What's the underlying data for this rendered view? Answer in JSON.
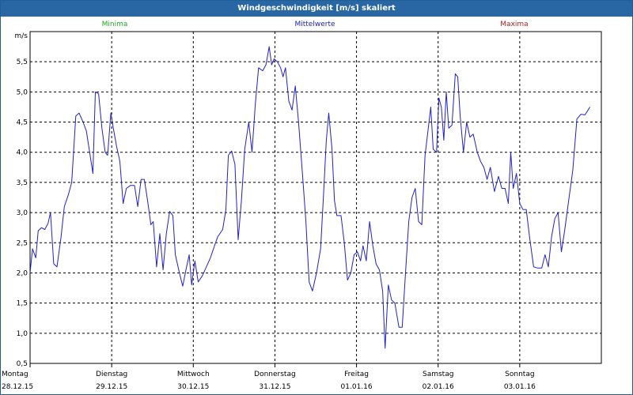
{
  "window": {
    "title": "Windgeschwindigkeit [m/s] skaliert"
  },
  "legend": [
    {
      "label": "Minima",
      "color": "#22aa22"
    },
    {
      "label": "Mittelwerte",
      "color": "#2020cc"
    },
    {
      "label": "Maxima",
      "color": "#aa2222"
    }
  ],
  "chart_data": {
    "type": "line",
    "title": "Windgeschwindigkeit [m/s] skaliert",
    "ylabel": "m/s",
    "xlabel": "",
    "ylim": [
      0.5,
      6.0
    ],
    "yticks": [
      "0,5",
      "1,0",
      "1,5",
      "2,0",
      "2,5",
      "3,0",
      "3,5",
      "4,0",
      "4,5",
      "5,0",
      "5,5"
    ],
    "yticks_values": [
      0.5,
      1.0,
      1.5,
      2.0,
      2.5,
      3.0,
      3.5,
      4.0,
      4.5,
      5.0,
      5.5
    ],
    "xlim": [
      0,
      7
    ],
    "xticks": [
      {
        "day": "Montag",
        "date": "28.12.15"
      },
      {
        "day": "Dienstag",
        "date": "29.12.15"
      },
      {
        "day": "Mittwoch",
        "date": "30.12.15"
      },
      {
        "day": "Donnerstag",
        "date": "31.12.15"
      },
      {
        "day": "Freitag",
        "date": "01.01.16"
      },
      {
        "day": "Samstag",
        "date": "02.01.16"
      },
      {
        "day": "Sonntag",
        "date": "03.01.16"
      }
    ],
    "grid": true,
    "series": [
      {
        "name": "Mittelwerte",
        "color": "#2020cc",
        "points": [
          [
            0.0,
            2.0
          ],
          [
            0.03,
            2.4
          ],
          [
            0.07,
            2.25
          ],
          [
            0.1,
            2.7
          ],
          [
            0.14,
            2.75
          ],
          [
            0.18,
            2.72
          ],
          [
            0.22,
            2.82
          ],
          [
            0.25,
            3.0
          ],
          [
            0.29,
            2.15
          ],
          [
            0.33,
            2.1
          ],
          [
            0.38,
            2.6
          ],
          [
            0.42,
            3.1
          ],
          [
            0.47,
            3.3
          ],
          [
            0.51,
            3.5
          ],
          [
            0.56,
            4.6
          ],
          [
            0.6,
            4.65
          ],
          [
            0.65,
            4.5
          ],
          [
            0.69,
            4.35
          ],
          [
            0.73,
            4.0
          ],
          [
            0.77,
            3.65
          ],
          [
            0.8,
            5.0
          ],
          [
            0.84,
            4.97
          ],
          [
            0.88,
            4.4
          ],
          [
            0.92,
            4.0
          ],
          [
            0.95,
            3.95
          ],
          [
            0.99,
            4.65
          ],
          [
            1.02,
            4.4
          ],
          [
            1.06,
            4.1
          ],
          [
            1.1,
            3.85
          ],
          [
            1.14,
            3.15
          ],
          [
            1.18,
            3.4
          ],
          [
            1.23,
            3.45
          ],
          [
            1.28,
            3.45
          ],
          [
            1.32,
            3.1
          ],
          [
            1.36,
            3.55
          ],
          [
            1.4,
            3.55
          ],
          [
            1.44,
            3.2
          ],
          [
            1.48,
            2.8
          ],
          [
            1.51,
            2.85
          ],
          [
            1.55,
            2.1
          ],
          [
            1.59,
            2.65
          ],
          [
            1.63,
            2.05
          ],
          [
            1.67,
            2.65
          ],
          [
            1.71,
            3.02
          ],
          [
            1.75,
            2.95
          ],
          [
            1.78,
            2.3
          ],
          [
            1.83,
            2.0
          ],
          [
            1.87,
            1.78
          ],
          [
            1.91,
            2.05
          ],
          [
            1.95,
            2.3
          ],
          [
            1.98,
            1.8
          ],
          [
            2.02,
            2.2
          ],
          [
            2.06,
            1.85
          ],
          [
            2.11,
            1.95
          ],
          [
            2.16,
            2.1
          ],
          [
            2.21,
            2.25
          ],
          [
            2.26,
            2.45
          ],
          [
            2.3,
            2.6
          ],
          [
            2.36,
            2.72
          ],
          [
            2.4,
            3.05
          ],
          [
            2.43,
            3.95
          ],
          [
            2.47,
            4.02
          ],
          [
            2.51,
            3.8
          ],
          [
            2.55,
            2.55
          ],
          [
            2.59,
            3.2
          ],
          [
            2.63,
            4.05
          ],
          [
            2.68,
            4.5
          ],
          [
            2.72,
            4.0
          ],
          [
            2.76,
            4.8
          ],
          [
            2.8,
            5.4
          ],
          [
            2.85,
            5.35
          ],
          [
            2.89,
            5.45
          ],
          [
            2.93,
            5.75
          ],
          [
            2.96,
            5.45
          ],
          [
            2.99,
            5.55
          ],
          [
            3.03,
            5.5
          ],
          [
            3.07,
            5.4
          ],
          [
            3.1,
            5.25
          ],
          [
            3.13,
            5.4
          ],
          [
            3.17,
            4.85
          ],
          [
            3.21,
            4.7
          ],
          [
            3.25,
            5.1
          ],
          [
            3.29,
            4.5
          ],
          [
            3.34,
            3.6
          ],
          [
            3.38,
            2.85
          ],
          [
            3.42,
            1.85
          ],
          [
            3.46,
            1.7
          ],
          [
            3.51,
            2.0
          ],
          [
            3.56,
            2.4
          ],
          [
            3.6,
            3.4
          ],
          [
            3.63,
            4.2
          ],
          [
            3.66,
            4.65
          ],
          [
            3.7,
            4.05
          ],
          [
            3.73,
            3.2
          ],
          [
            3.76,
            2.95
          ],
          [
            3.81,
            2.95
          ],
          [
            3.85,
            2.5
          ],
          [
            3.89,
            1.88
          ],
          [
            3.93,
            2.0
          ],
          [
            3.97,
            2.3
          ],
          [
            4.01,
            2.35
          ],
          [
            4.05,
            2.2
          ],
          [
            4.08,
            2.45
          ],
          [
            4.12,
            2.2
          ],
          [
            4.16,
            2.85
          ],
          [
            4.2,
            2.45
          ],
          [
            4.24,
            2.15
          ],
          [
            4.28,
            2.05
          ],
          [
            4.32,
            1.7
          ],
          [
            4.35,
            0.75
          ],
          [
            4.39,
            1.8
          ],
          [
            4.43,
            1.55
          ],
          [
            4.47,
            1.5
          ],
          [
            4.52,
            1.1
          ],
          [
            4.56,
            1.1
          ],
          [
            4.6,
            2.0
          ],
          [
            4.64,
            2.85
          ],
          [
            4.68,
            3.25
          ],
          [
            4.72,
            3.4
          ],
          [
            4.76,
            2.85
          ],
          [
            4.8,
            2.8
          ],
          [
            4.84,
            3.95
          ],
          [
            4.88,
            4.4
          ],
          [
            4.91,
            4.75
          ],
          [
            4.94,
            4.05
          ],
          [
            4.98,
            4.0
          ],
          [
            5.01,
            4.9
          ],
          [
            5.04,
            4.75
          ],
          [
            5.07,
            4.2
          ],
          [
            5.1,
            5.0
          ],
          [
            5.13,
            4.4
          ],
          [
            5.17,
            4.45
          ],
          [
            5.21,
            5.3
          ],
          [
            5.24,
            5.25
          ],
          [
            5.27,
            4.6
          ],
          [
            5.31,
            4.0
          ],
          [
            5.35,
            4.5
          ],
          [
            5.39,
            4.25
          ],
          [
            5.43,
            4.3
          ],
          [
            5.48,
            4.0
          ],
          [
            5.52,
            3.85
          ],
          [
            5.56,
            3.75
          ],
          [
            5.6,
            3.55
          ],
          [
            5.64,
            3.75
          ],
          [
            5.69,
            3.35
          ],
          [
            5.74,
            3.6
          ],
          [
            5.78,
            3.4
          ],
          [
            5.82,
            3.4
          ],
          [
            5.86,
            3.15
          ],
          [
            5.89,
            4.0
          ],
          [
            5.92,
            3.4
          ],
          [
            5.96,
            3.65
          ],
          [
            6.0,
            3.15
          ],
          [
            6.04,
            3.05
          ],
          [
            6.08,
            3.05
          ],
          [
            6.12,
            2.6
          ],
          [
            6.17,
            2.1
          ],
          [
            6.22,
            2.08
          ],
          [
            6.27,
            2.08
          ],
          [
            6.31,
            2.3
          ],
          [
            6.35,
            2.1
          ],
          [
            6.39,
            2.6
          ],
          [
            6.43,
            2.9
          ],
          [
            6.47,
            3.0
          ],
          [
            6.51,
            2.35
          ],
          [
            6.55,
            2.7
          ],
          [
            6.6,
            3.2
          ],
          [
            6.65,
            3.7
          ],
          [
            6.7,
            4.55
          ],
          [
            6.75,
            4.63
          ],
          [
            6.8,
            4.62
          ],
          [
            6.86,
            4.75
          ]
        ]
      }
    ]
  }
}
